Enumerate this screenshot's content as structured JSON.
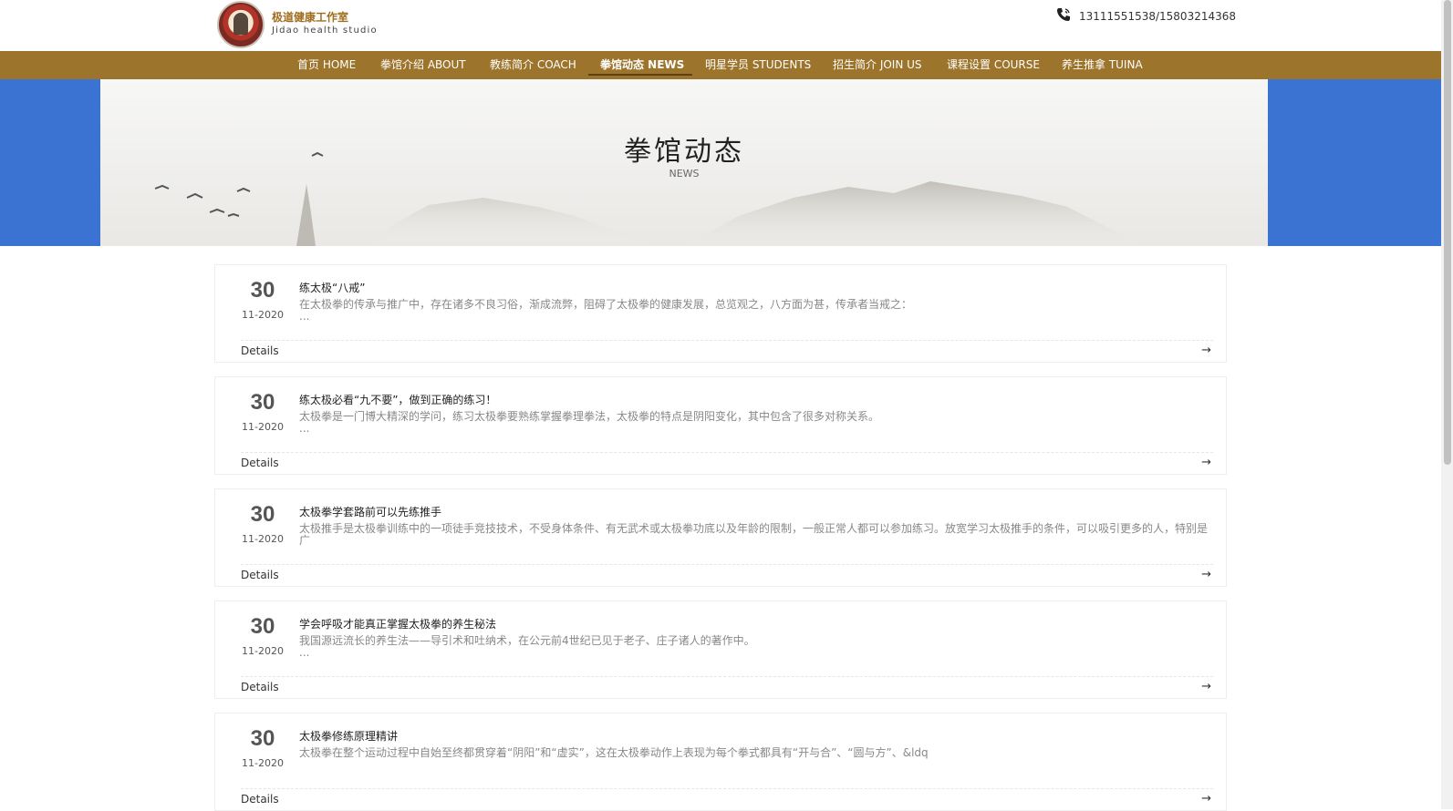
{
  "header": {
    "brand_cn": "极道健康工作室",
    "brand_en": "Jidao health studio",
    "phone": "13111551538/15803214368"
  },
  "nav": [
    {
      "label": "首页 HOME",
      "active": false
    },
    {
      "label": "拳馆介绍 ABOUT",
      "active": false
    },
    {
      "label": "教练简介 COACH",
      "active": false
    },
    {
      "label": "拳馆动态 NEWS",
      "active": true
    },
    {
      "label": "明星学员 STUDENTS",
      "active": false
    },
    {
      "label": "招生简介 JOIN US",
      "active": false
    },
    {
      "label": "课程设置 COURSE",
      "active": false
    },
    {
      "label": "养生推拿 TUINA",
      "active": false
    }
  ],
  "banner": {
    "title": "拳馆动态",
    "subtitle": "NEWS"
  },
  "news": [
    {
      "day": "30",
      "monthyear": "11-2020",
      "title": "练太极“八戒”",
      "summary": "在太极拳的传承与推广中，存在诸多不良习俗，渐成流弊，阻碍了太极拳的健康发展，总览观之，八方面为甚，传承者当戒之：",
      "ellipsis": "...",
      "details": "Details",
      "arrow": "→"
    },
    {
      "day": "30",
      "monthyear": "11-2020",
      "title": "练太极必看“九不要”，做到正确的练习！",
      "summary": "太极拳是一门博大精深的学问，练习太极拳要熟练掌握拳理拳法，太极拳的特点是阴阳变化，其中包含了很多对称关系。",
      "ellipsis": "...",
      "details": "Details",
      "arrow": "→"
    },
    {
      "day": "30",
      "monthyear": "11-2020",
      "title": "太极拳学套路前可以先练推手",
      "summary": "太极推手是太极拳训练中的一项徒手竞技技术，不受身体条件、有无武术或太极拳功底以及年龄的限制，一般正常人都可以参加练习。放宽学习太极推手的条件，可以吸引更多的人，特别是广",
      "ellipsis": "",
      "details": "Details",
      "arrow": "→"
    },
    {
      "day": "30",
      "monthyear": "11-2020",
      "title": "学会呼吸才能真正掌握太极拳的养生秘法",
      "summary": "我国源远流长的养生法——导引术和吐纳术，在公元前4世纪已见于老子、庄子诸人的著作中。",
      "ellipsis": "...",
      "details": "Details",
      "arrow": "→"
    },
    {
      "day": "30",
      "monthyear": "11-2020",
      "title": "太极拳修练原理精讲",
      "summary": "太极拳在整个运动过程中自始至终都贯穿着“阴阳”和“虚实”，这在太极拳动作上表现为每个拳式都具有“开与合”、“圆与方”、&ldq",
      "ellipsis": "",
      "details": "Details",
      "arrow": "→"
    }
  ]
}
